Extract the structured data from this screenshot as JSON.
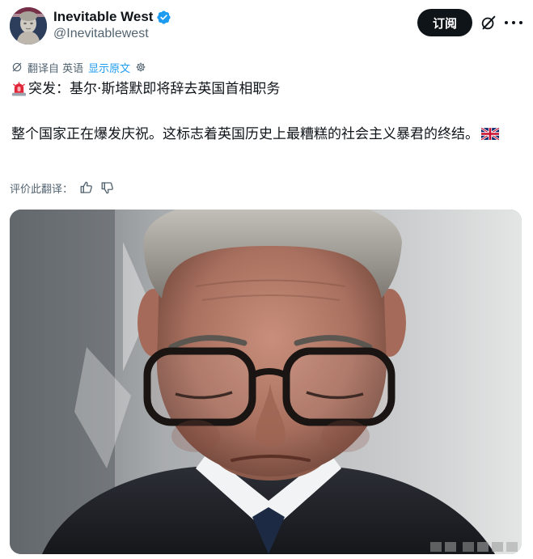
{
  "author": {
    "display_name": "Inevitable West",
    "handle": "@Inevitablewest",
    "avatar_icon": "avatar-statue-icon",
    "verified_color": "#1d9bf0"
  },
  "header": {
    "subscribe_label": "订阅",
    "grok_icon": "grok-icon",
    "more_icon": "more-options-icon"
  },
  "translation": {
    "translated_from": "翻译自 英语",
    "show_original": "显示原文",
    "settings_icon": "gear-icon"
  },
  "post": {
    "line1_emoji": "siren-emoji",
    "line1_text": "突发：基尔·斯塔默即将辞去英国首相职务",
    "para2_text": "整个国家正在爆发庆祝。这标志着英国历史上最糟糕的社会主义暴君的终结。",
    "para2_emoji": "uk-flag-emoji"
  },
  "rate_translation": {
    "label": "评价此翻译：",
    "thumbs_up_icon": "thumbs-up-icon",
    "thumbs_down_icon": "thumbs-down-icon"
  },
  "media": {
    "type": "photo",
    "subject": "man-wearing-glasses-looking-down"
  },
  "colors": {
    "text_primary": "#0f1419",
    "text_secondary": "#536471",
    "link_blue": "#1d9bf0",
    "button_bg": "#0f1419",
    "button_text": "#ffffff"
  }
}
